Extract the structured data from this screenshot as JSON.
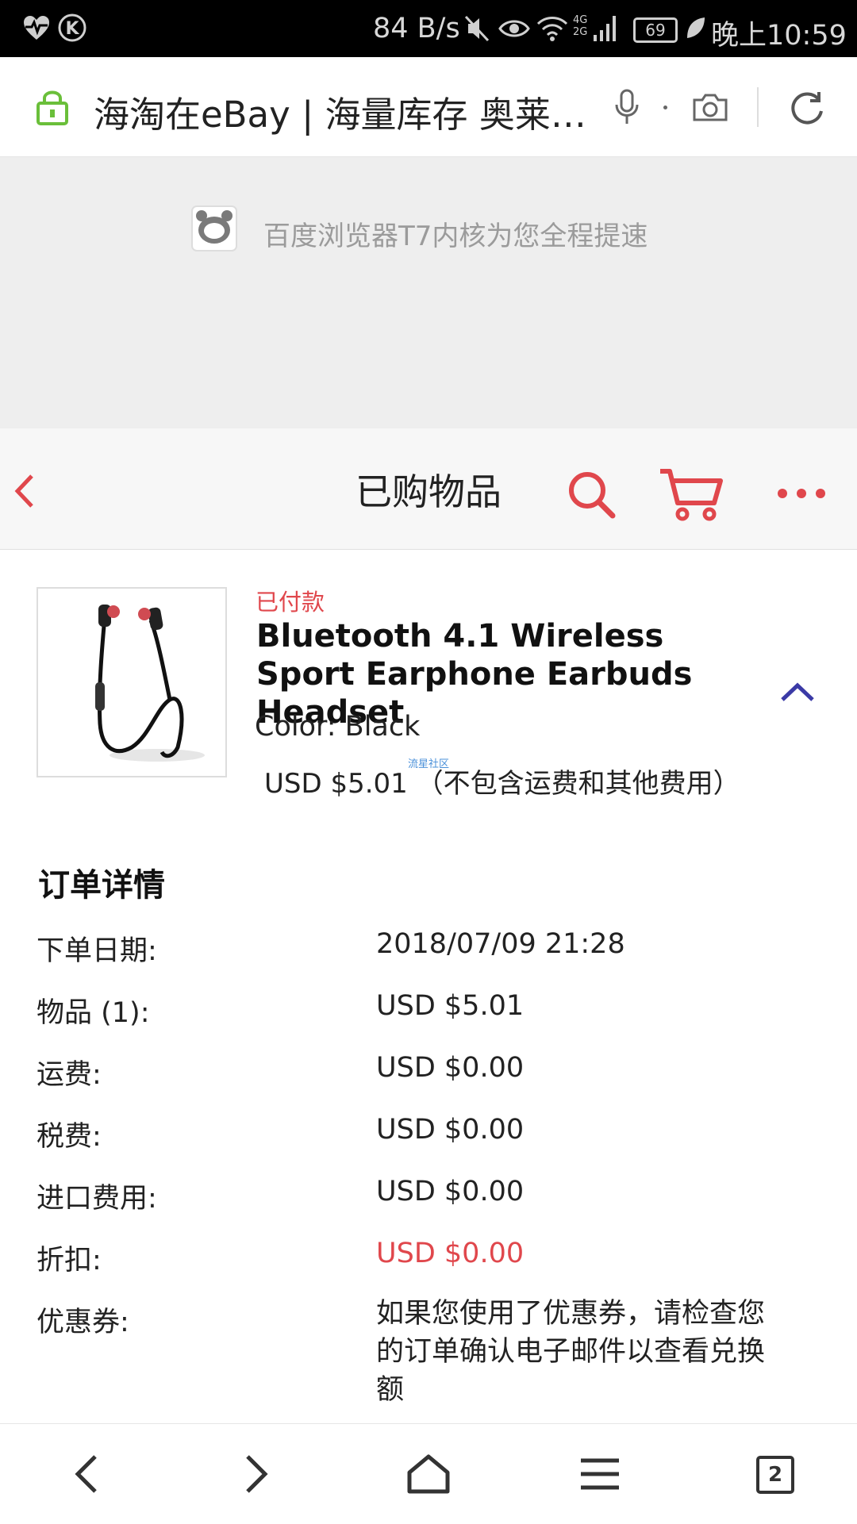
{
  "status_bar": {
    "speed": "84 B/s",
    "battery": "69",
    "time": "晚上10:59",
    "network": "4G 2G",
    "icons": [
      "heart-pulse-icon",
      "k-icon",
      "mute-icon",
      "eye-icon",
      "wifi-icon",
      "signal-icon",
      "battery-icon",
      "leaf-icon"
    ]
  },
  "url_bar": {
    "title": "海淘在eBay | 海量库存 奥莱…",
    "icons": [
      "lock-icon",
      "mic-icon",
      "camera-icon",
      "refresh-icon"
    ]
  },
  "banner": {
    "text": "百度浏览器T7内核为您全程提速",
    "icon": "bear-icon"
  },
  "header": {
    "title": "已购物品",
    "icons": [
      "back-icon",
      "search-icon",
      "cart-icon",
      "more-icon"
    ],
    "accent": "#e0474c"
  },
  "product": {
    "status": "已付款",
    "title": "Bluetooth 4.1 Wireless Sport Earphone Earbuds Headset",
    "color": "Color: Black",
    "price": "USD $5.01 （不包含运费和其他费用）",
    "watermark": "流星社区",
    "image": "earphones-image",
    "collapse_icon": "chevron-up-icon"
  },
  "order_details": {
    "title": "订单详情",
    "rows": [
      {
        "label": "下单日期:",
        "value": "2018/07/09 21:28"
      },
      {
        "label": "物品 (1):",
        "value": "USD $5.01"
      },
      {
        "label": "运费:",
        "value": "USD $0.00"
      },
      {
        "label": "税费:",
        "value": "USD $0.00"
      },
      {
        "label": "进口费用:",
        "value": "USD $0.00"
      },
      {
        "label": "折扣:",
        "value": "USD $0.00"
      },
      {
        "label": "优惠券:",
        "value": "如果您使用了优惠券，请检查您的订单确认电子邮件以查看兑换额"
      }
    ]
  },
  "bottom_nav": {
    "tab_count": "2",
    "icons": [
      "nav-back-icon",
      "nav-forward-icon",
      "home-icon",
      "menu-icon",
      "tabs-icon"
    ]
  }
}
